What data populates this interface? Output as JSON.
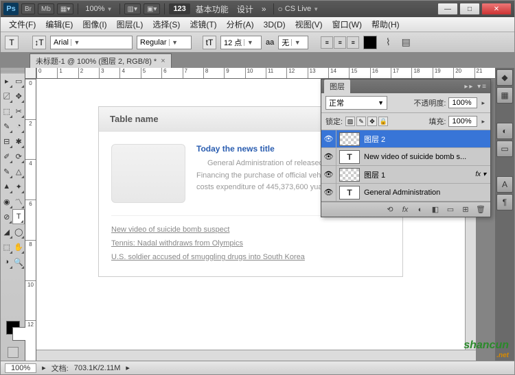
{
  "topbar": {
    "ps": "Ps",
    "br": "Br",
    "mb": "Mb",
    "zoom": "100%",
    "badge": "123",
    "basic": "基本功能",
    "design": "设计",
    "more": "»",
    "cslive": "CS Live",
    "min": "—",
    "max": "□",
    "close": "✕"
  },
  "menu": [
    "文件(F)",
    "编辑(E)",
    "图像(I)",
    "图层(L)",
    "选择(S)",
    "滤镜(T)",
    "分析(A)",
    "3D(D)",
    "视图(V)",
    "窗口(W)",
    "帮助(H)"
  ],
  "options": {
    "tool": "T",
    "orient": "↕T",
    "font": "Arial",
    "weight": "Regular",
    "sizeIcon": "tT",
    "size": "12 点",
    "aaLabel": "aa",
    "aa": "无"
  },
  "tab": {
    "title": "未标题-1 @ 100% (图层 2, RGB/8) *",
    "close": "×"
  },
  "rulerH": [
    "0",
    "1",
    "2",
    "3",
    "4",
    "5",
    "6",
    "7",
    "8",
    "9",
    "10",
    "11",
    "12",
    "13",
    "14",
    "15",
    "16",
    "17",
    "18",
    "19",
    "20",
    "21"
  ],
  "rulerV": [
    "0",
    "2",
    "4",
    "6",
    "8",
    "10",
    "12"
  ],
  "doc": {
    "tableName": "Table name",
    "newsTitle": "Today the news title",
    "newsDesc": "General Administration of released the 2011 \"Three Financing the purchase of official vehicles and running costs expenditure of 445,373,600 yuan,",
    "links": [
      "New video of suicide bomb suspect",
      "Tennis: Nadal withdraws from Olympics",
      "U.S. soldier accused of smuggling drugs into South Korea"
    ]
  },
  "layers": {
    "tab": "图层",
    "blend": "正常",
    "opacityLabel": "不透明度:",
    "opacity": "100%",
    "lockLabel": "锁定:",
    "fillLabel": "填充:",
    "fill": "100%",
    "items": [
      {
        "name": "图层 2",
        "type": "raster",
        "selected": true
      },
      {
        "name": "New video of suicide bomb s...",
        "type": "text",
        "selected": false
      },
      {
        "name": "图层 1",
        "type": "raster",
        "selected": false,
        "fx": "fx"
      },
      {
        "name": "General Administration",
        "type": "text",
        "selected": false
      }
    ],
    "bottomIcons": [
      "⟲",
      "fx",
      "◐",
      "◧",
      "▭",
      "⊞",
      "🗑"
    ]
  },
  "status": {
    "zoom": "100%",
    "docLabel": "文档:",
    "docInfo": "703.1K/2.11M"
  },
  "watermark": {
    "main": "shancun",
    "sub": ".net"
  },
  "tools": [
    [
      "▸",
      "▭"
    ],
    [
      "〼",
      "✥"
    ],
    [
      "⬚",
      "✂"
    ],
    [
      "✎",
      "◔"
    ],
    [
      "⊟",
      "✱"
    ],
    [
      "✐",
      "⟳"
    ],
    [
      "✎",
      "△"
    ],
    [
      "▲",
      "✦"
    ],
    [
      "◉",
      "〽"
    ],
    [
      "⊘",
      "T"
    ],
    [
      "◢",
      "◯"
    ],
    [
      "⬚",
      "✋"
    ],
    [
      "◑",
      "🔍"
    ]
  ]
}
